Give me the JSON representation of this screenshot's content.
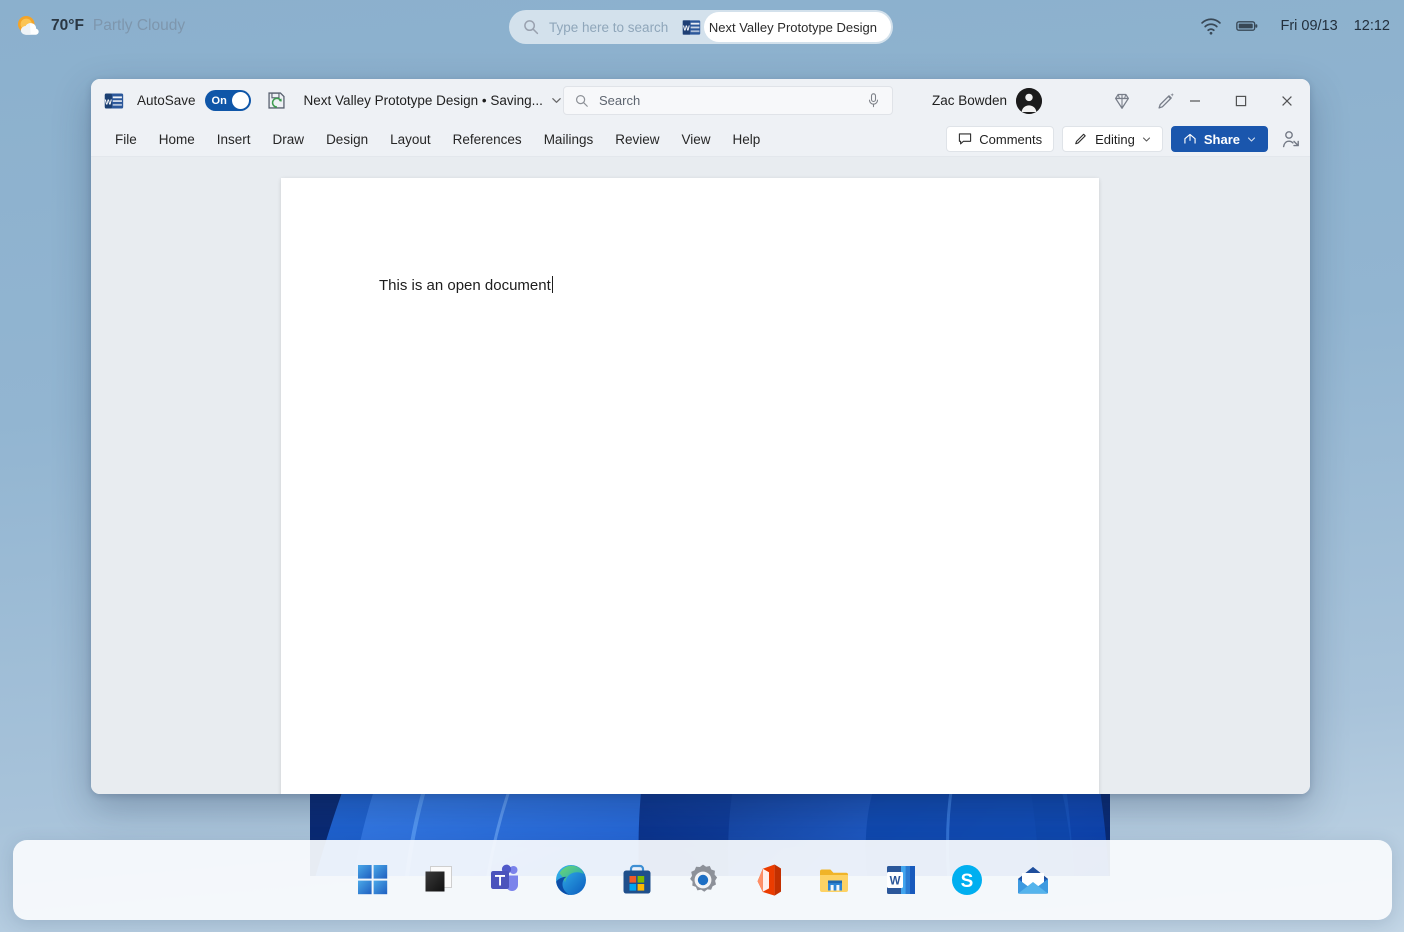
{
  "statusbar": {
    "weather": {
      "icon": "sun-cloud-icon",
      "temperature": "70°F",
      "condition": "Partly Cloudy"
    },
    "search": {
      "icon": "search-icon",
      "placeholder": "Type here to search"
    },
    "active_task": {
      "icon": "word-app-icon",
      "label": "Next Valley Prototype Design"
    },
    "tray": {
      "wifi_icon": "wifi-icon",
      "battery_icon": "battery-icon",
      "date": "Fri 09/13",
      "time": "12:12"
    }
  },
  "word": {
    "titlebar": {
      "app_icon": "word-app-icon",
      "autosave_label": "AutoSave",
      "autosave_state": "On",
      "save_status_icon": "save-sync-icon",
      "document_title": "Next Valley Prototype Design • Saving...",
      "title_dropdown_icon": "chevron-down-icon",
      "search_placeholder": "Search",
      "search_icon": "search-icon",
      "mic_icon": "microphone-icon",
      "user_name": "Zac Bowden",
      "avatar_icon": "user-avatar",
      "diamond_icon": "diamond-icon",
      "designer_icon": "pen-sparkle-icon",
      "minimize_icon": "minimize-icon",
      "maximize_icon": "maximize-icon",
      "close_icon": "close-icon"
    },
    "ribbon": {
      "tabs": [
        {
          "label": "File"
        },
        {
          "label": "Home"
        },
        {
          "label": "Insert"
        },
        {
          "label": "Draw"
        },
        {
          "label": "Design"
        },
        {
          "label": "Layout"
        },
        {
          "label": "References"
        },
        {
          "label": "Mailings"
        },
        {
          "label": "Review"
        },
        {
          "label": "View"
        },
        {
          "label": "Help"
        }
      ],
      "comments_label": "Comments",
      "comments_icon": "comment-icon",
      "editing_label": "Editing",
      "editing_icon": "pencil-icon",
      "editing_chevron_icon": "chevron-down-icon",
      "share_label": "Share",
      "share_icon": "share-icon",
      "share_chevron_icon": "chevron-down-icon",
      "collaborators_icon": "person-arrow-icon"
    },
    "document": {
      "body_text": "This is an open document"
    }
  },
  "taskbar": {
    "items": [
      {
        "icon": "start-windows-icon",
        "label": "Start"
      },
      {
        "icon": "task-view-icon",
        "label": "Task View"
      },
      {
        "icon": "microsoft-teams-icon",
        "label": "Microsoft Teams"
      },
      {
        "icon": "microsoft-edge-icon",
        "label": "Microsoft Edge"
      },
      {
        "icon": "microsoft-store-icon",
        "label": "Microsoft Store"
      },
      {
        "icon": "settings-gear-icon",
        "label": "Settings"
      },
      {
        "icon": "microsoft-office-icon",
        "label": "Office"
      },
      {
        "icon": "file-explorer-icon",
        "label": "File Explorer"
      },
      {
        "icon": "microsoft-word-icon",
        "label": "Word"
      },
      {
        "icon": "skype-icon",
        "label": "Skype"
      },
      {
        "icon": "mail-icon",
        "label": "Mail"
      }
    ]
  },
  "colors": {
    "accent_blue": "#1a56ad",
    "desktop_top": "#8bb0cd",
    "desktop_bottom": "#c3d6e6",
    "word_chrome": "#eef1f5"
  }
}
